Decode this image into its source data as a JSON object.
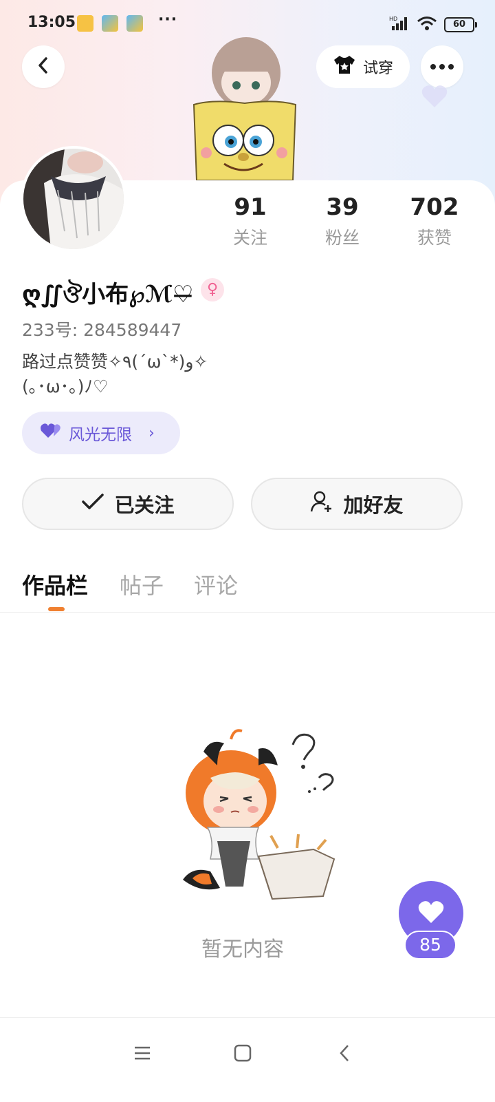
{
  "status_bar": {
    "time": "13:05",
    "more": "···",
    "network_label": "HD",
    "battery": "60"
  },
  "header": {
    "back_icon": "chevron-left-icon",
    "tryon_label": "试穿",
    "tryon_icon": "tshirt-icon",
    "more_icon": "more-icon"
  },
  "profile": {
    "nickname": "ღ∬ঔ小布℘ℳ♡̶",
    "gender_icon": "female-icon",
    "uid": "233号: 284589447",
    "bio_line1": "路过点赞赞✧٩(ˊωˋ*)و✧",
    "bio_line2": "(｡･ω･｡)ﾉ♡",
    "honor_label": "风光无限",
    "honor_icon": "purple-heart-icon"
  },
  "stats": [
    {
      "value": "91",
      "label": "关注"
    },
    {
      "value": "39",
      "label": "粉丝"
    },
    {
      "value": "702",
      "label": "获赞"
    }
  ],
  "actions": {
    "followed_label": "已关注",
    "add_friend_label": "加好友"
  },
  "tabs": [
    {
      "label": "作品栏",
      "active": true
    },
    {
      "label": "帖子",
      "active": false
    },
    {
      "label": "评论",
      "active": false
    }
  ],
  "empty": {
    "text": "暂无内容"
  },
  "like": {
    "count": "85"
  },
  "colors": {
    "accent": "#7c68ea",
    "tab_indicator": "#f08030",
    "honor_bg": "#ecebfb"
  }
}
